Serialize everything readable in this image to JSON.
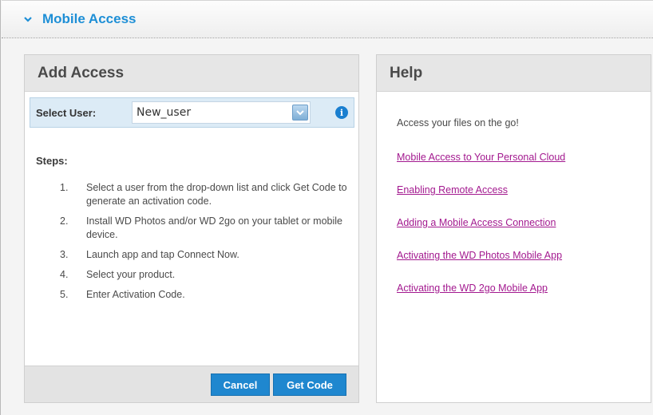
{
  "section": {
    "title": "Mobile Access",
    "chevron_icon": "chevron-down-icon",
    "accent_color": "#1e8fd6"
  },
  "add_access": {
    "title": "Add Access",
    "select_user": {
      "label": "Select User:",
      "value": "New_user"
    },
    "steps_title": "Steps:",
    "steps": [
      {
        "num": "1.",
        "text": "Select a user from the drop-down list and click Get Code to generate an activation code."
      },
      {
        "num": "2.",
        "text": "Install WD Photos and/or WD 2go on your tablet or mobile device."
      },
      {
        "num": "3.",
        "text": "Launch app and tap Connect Now."
      },
      {
        "num": "4.",
        "text": "Select your product."
      },
      {
        "num": "5.",
        "text": "Enter Activation Code."
      }
    ],
    "buttons": {
      "cancel": "Cancel",
      "get_code": "Get Code"
    }
  },
  "help": {
    "title": "Help",
    "intro": "Access your files on the go!",
    "links": [
      "Mobile Access to Your Personal Cloud",
      "Enabling Remote Access",
      "Adding a Mobile Access Connection",
      "Activating the WD Photos Mobile App",
      "Activating the WD 2go Mobile App"
    ],
    "link_color": "#a3198f"
  }
}
